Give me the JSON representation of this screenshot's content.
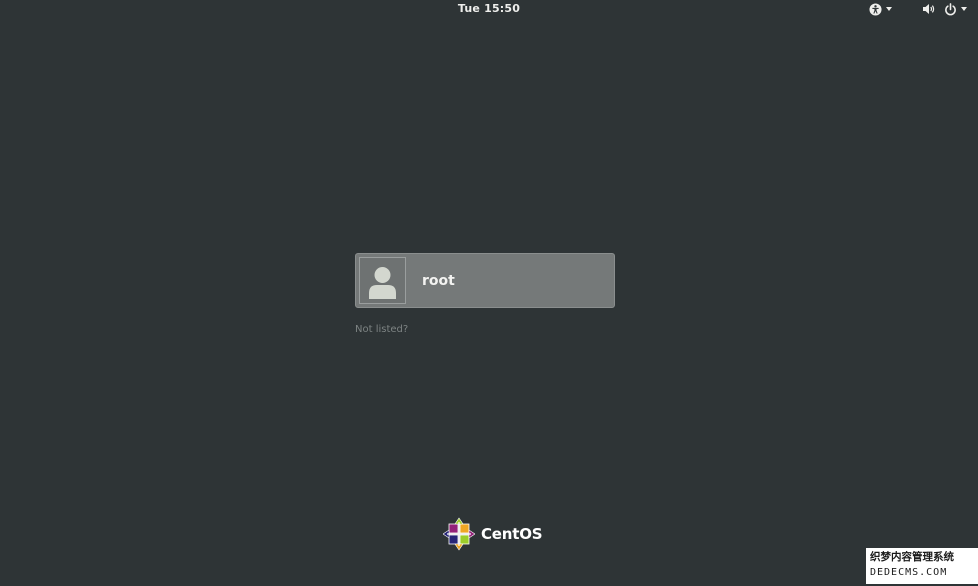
{
  "top_bar": {
    "clock": "Tue 15:50",
    "accessibility_icon": "accessibility-icon",
    "volume_icon": "volume-icon",
    "power_icon": "power-icon",
    "dropdown_icon": "triangle-down-icon"
  },
  "user_list": {
    "users": [
      {
        "name": "root",
        "avatar_icon": "default-user-avatar-icon"
      }
    ],
    "not_listed_label": "Not listed?"
  },
  "branding": {
    "logo_icon": "centos-logo-icon",
    "name": "CentOS"
  },
  "watermark": {
    "line1": "织梦内容管理系统",
    "line2": "DEDECMS.COM"
  },
  "colors": {
    "background": "#2e3436",
    "user_row": "#757979",
    "text": "#eeeeec",
    "link_dim": "#7d8383"
  }
}
